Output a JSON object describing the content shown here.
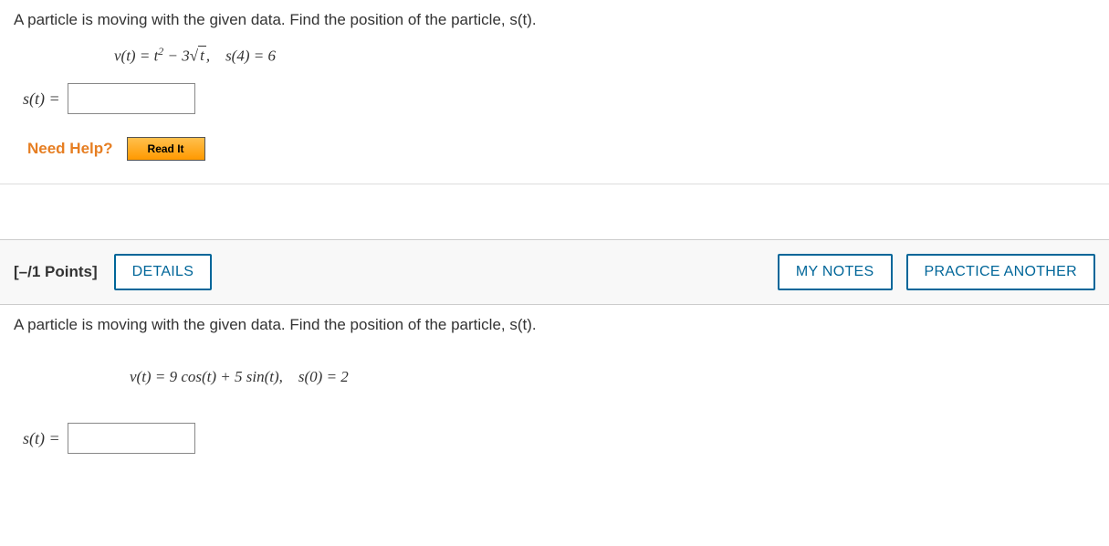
{
  "q1": {
    "prompt": "A particle is moving with the given data. Find the position of the particle, s(t).",
    "equation_prefix": "v(t) = t",
    "equation_sup": "2",
    "equation_mid": " − 3",
    "sqrt_sym": "√",
    "sqrt_arg": "t",
    "equation_tail": ",    s(4) = 6",
    "answer_label": "s(t) = ",
    "help_label": "Need Help?",
    "read_it": "Read It"
  },
  "header": {
    "points": "[–/1 Points]",
    "details": "DETAILS",
    "my_notes": "MY NOTES",
    "practice": "PRACTICE ANOTHER"
  },
  "q2": {
    "prompt": "A particle is moving with the given data. Find the position of the particle, s(t).",
    "equation": "v(t) = 9 cos(t) + 5 sin(t),    s(0) = 2",
    "answer_label": "s(t) = "
  }
}
